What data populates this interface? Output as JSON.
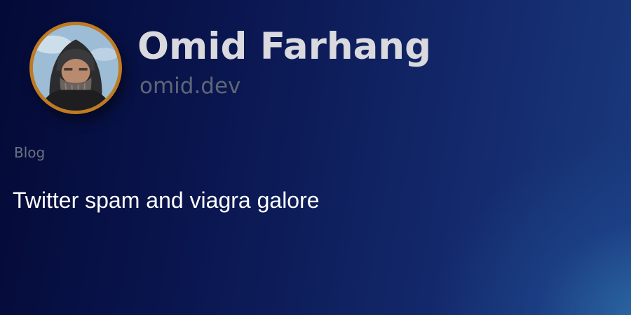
{
  "profile": {
    "name": "Omid Farhang",
    "site": "omid.dev",
    "avatar_icon": "avatar-photo"
  },
  "post": {
    "category": "Blog",
    "title": "Twitter spam and viagra galore"
  },
  "colors": {
    "avatar_ring": "#c07a22",
    "name_text": "#d9d9de",
    "site_text": "#5f6676",
    "category_text": "#6c7180",
    "title_text": "#ffffff",
    "background_dark": "#040a36",
    "background_accent": "#2e6ea8"
  }
}
